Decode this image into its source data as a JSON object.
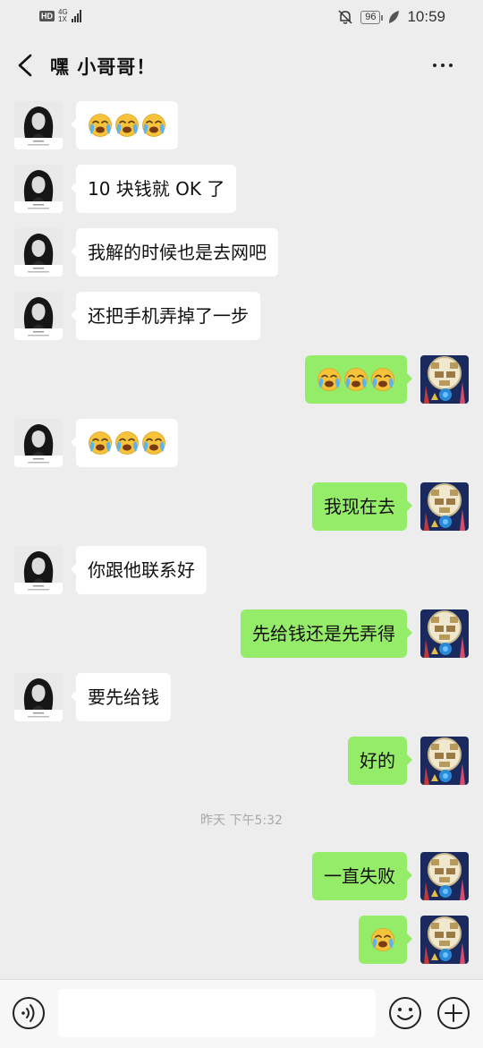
{
  "status_bar": {
    "hd": "HD",
    "network": "4G",
    "network_sub": "1X",
    "battery": "96",
    "time": "10:59"
  },
  "header": {
    "title": "嘿 小哥哥！"
  },
  "messages": [
    {
      "side": "left",
      "text": ""
    },
    {
      "side": "left",
      "text": "10 块钱就 OK 了"
    },
    {
      "side": "left",
      "text": "我解的时候也是去网吧"
    },
    {
      "side": "left",
      "text": "还把手机弄掉了一步"
    },
    {
      "side": "right",
      "text": ""
    },
    {
      "side": "left",
      "text": ""
    },
    {
      "side": "right",
      "text": "我现在去"
    },
    {
      "side": "left",
      "text": "你跟他联系好"
    },
    {
      "side": "right",
      "text": "先给钱还是先弄得"
    },
    {
      "side": "left",
      "text": "要先给钱"
    },
    {
      "side": "right",
      "text": "好的"
    },
    {
      "side": "right",
      "text": "一直失败"
    },
    {
      "side": "right",
      "text": ""
    }
  ],
  "timestamp": "昨天 下午5:32",
  "input": {
    "value": ""
  },
  "icons": {
    "back": "chevron-left-icon",
    "more": "more-dots-icon",
    "voice": "voice-icon",
    "emoji": "emoji-icon",
    "plus": "plus-icon",
    "crying": "loudly-crying-face-emoji"
  },
  "colors": {
    "background": "#ededed",
    "bubble_self": "#95ec69",
    "bubble_other": "#ffffff",
    "timestamp": "#a8a8a8"
  }
}
